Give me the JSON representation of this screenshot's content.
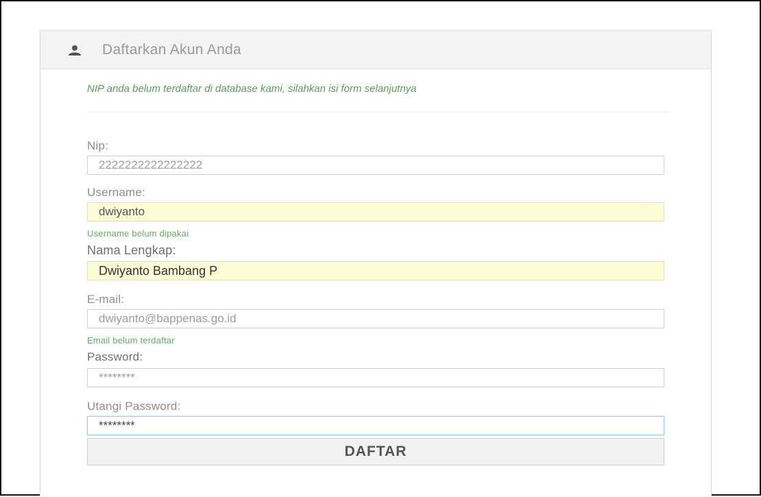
{
  "panel": {
    "title": "Daftarkan Akun Anda",
    "icon": "user-icon"
  },
  "notice": "NIP anda belum terdaftar di database kami, silahkan isi form selanjutnya",
  "form": {
    "nip": {
      "label": "Nip:",
      "value": "2222222222222222"
    },
    "username": {
      "label": "Username:",
      "value": "dwiyanto",
      "hint": "Username belum dipakai"
    },
    "nama_lengkap": {
      "label": "Nama Lengkap:",
      "value": "Dwiyanto Bambang P"
    },
    "email": {
      "label": "E-mail:",
      "value": "dwiyanto@bappenas.go.id",
      "hint": "Email belum terdaftar"
    },
    "password": {
      "label": "Password:",
      "value": "********"
    },
    "utangi_password": {
      "label": "Utangi Password:",
      "value": "********"
    },
    "submit_label": "DAFTAR"
  },
  "colors": {
    "notice_green": "#5c9a5c",
    "autofill_yellow": "#fbfbd6",
    "focus_blue": "#9ccfe0"
  }
}
